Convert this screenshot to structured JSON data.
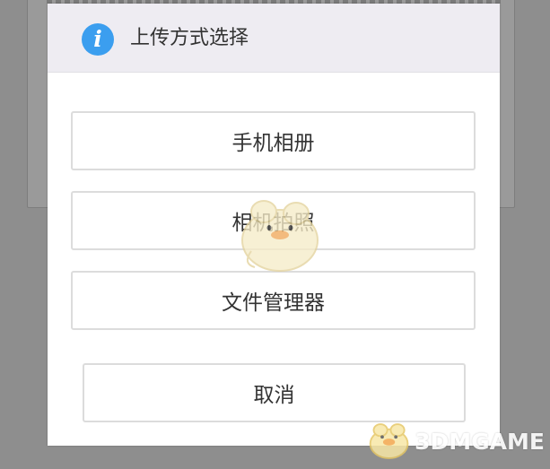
{
  "dialog": {
    "title": "上传方式选择",
    "icon": "info-icon",
    "icon_glyph": "i",
    "options": [
      {
        "label": "手机相册"
      },
      {
        "label": "相机拍照"
      },
      {
        "label": "文件管理器"
      }
    ],
    "cancel_label": "取消"
  },
  "watermark": {
    "text": "3DMGAME"
  },
  "colors": {
    "accent": "#3b9eef",
    "header_bg": "#eeecf2",
    "overlay": "#8e8e8e"
  }
}
